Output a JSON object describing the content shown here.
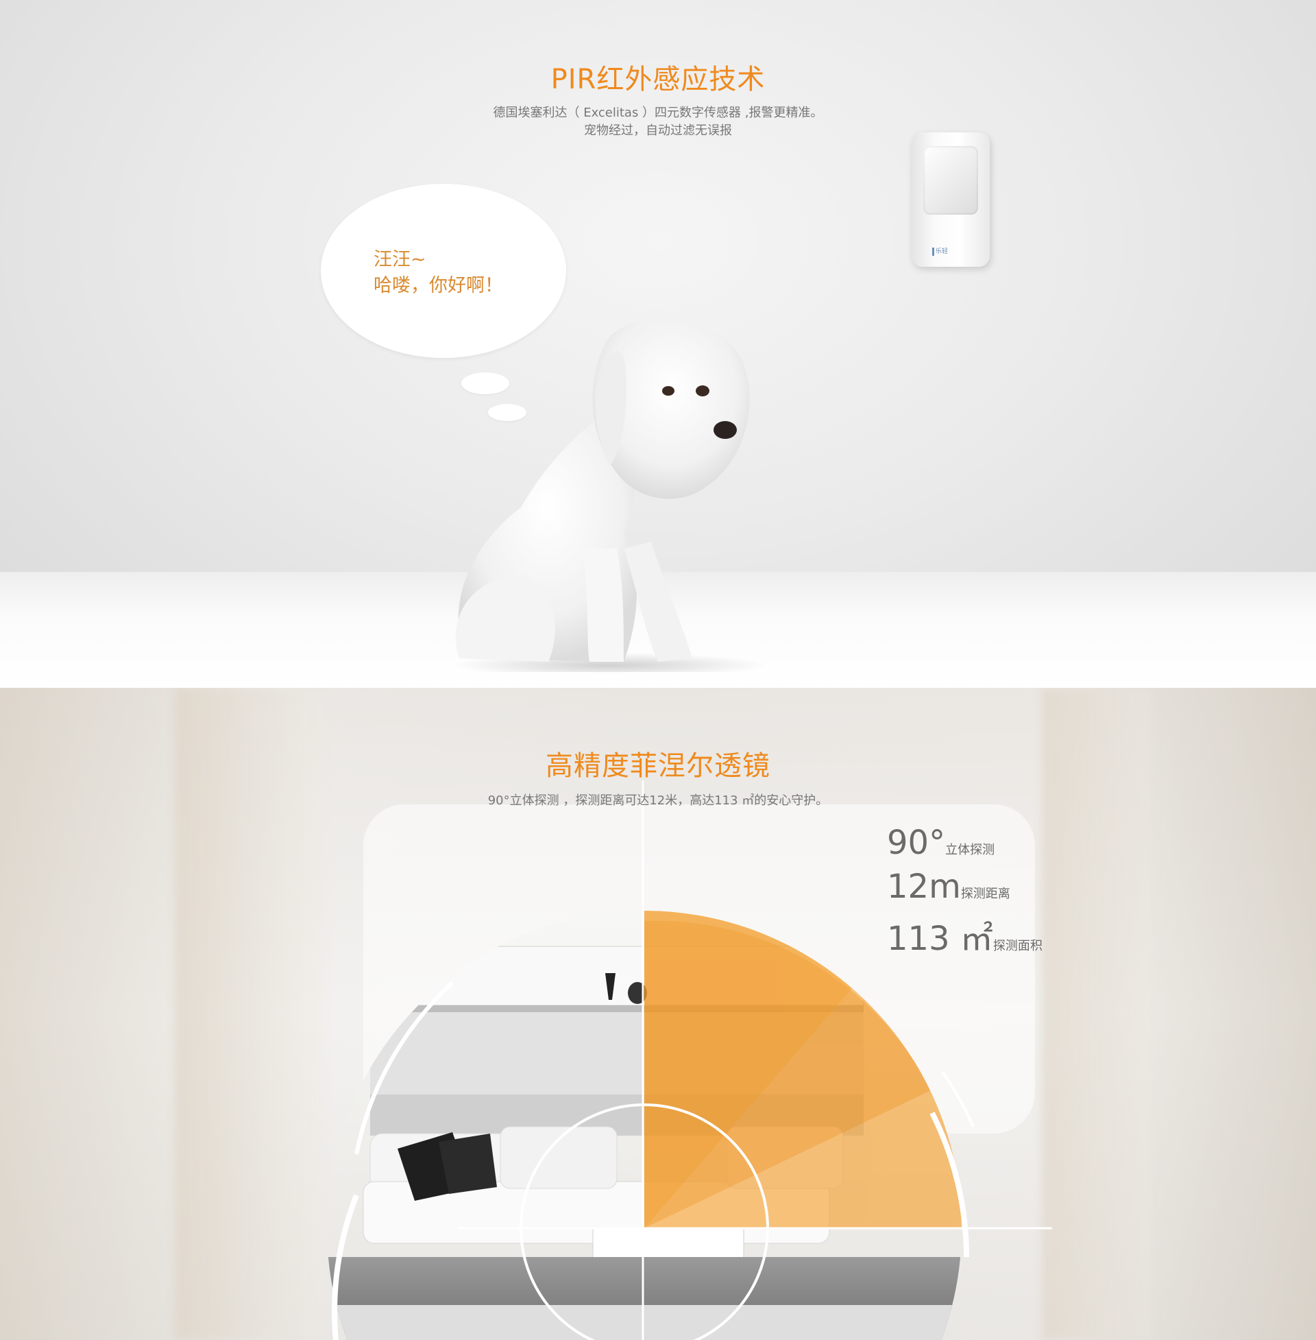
{
  "pir_section": {
    "title": "PIR红外感应技术",
    "desc_line1": "德国埃塞利达（ Excelitas ）四元数字传感器 ,报警更精准。",
    "desc_line2": "宠物经过，自动过滤无误报",
    "bubble_line1": "汪汪~",
    "bubble_line2": "哈喽，你好啊！",
    "device_logo": "乐轻"
  },
  "lens_section": {
    "title": "高精度菲涅尔透镜",
    "desc": "90°立体探测 ，探测距离可达12米，高达113 ㎡的安心守护。",
    "stats": [
      {
        "value": "90°",
        "label": "立体探测"
      },
      {
        "value": "12m",
        "label": "探测距离"
      },
      {
        "value": "113 ㎡",
        "label": "探测面积"
      }
    ]
  },
  "colors": {
    "accent": "#ef8a1e",
    "bubble_text": "#d98a2f",
    "fan_orange": "#f5a030",
    "body_text": "#777777"
  }
}
